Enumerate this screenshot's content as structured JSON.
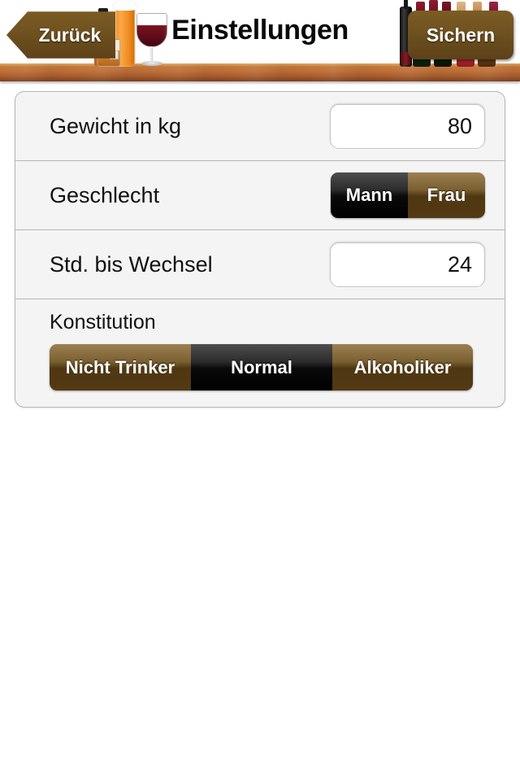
{
  "navbar": {
    "title": "Einstellungen",
    "back_label": "Zurück",
    "save_label": "Sichern",
    "colors": {
      "button_brown": "#6b4e1d",
      "shelf_wood": "#bd703a",
      "title_text": "#0a0a0a"
    },
    "decor": {
      "drinks_icon": "beer-wine-whiskey-glasses",
      "rack_icon": "wine-bottle-rack"
    }
  },
  "settings": {
    "weight": {
      "label": "Gewicht in kg",
      "value": "80",
      "placeholder": "kg"
    },
    "gender": {
      "label": "Geschlecht",
      "options": [
        "Mann",
        "Frau"
      ],
      "selected": "Mann"
    },
    "hours": {
      "label": "Std. bis Wechsel",
      "value": "24",
      "placeholder": "Std."
    },
    "constitution": {
      "label": "Konstitution",
      "options": [
        "Nicht Trinker",
        "Normal",
        "Alkoholiker"
      ],
      "selected": "Normal"
    },
    "colors": {
      "panel_bg": "#f4f4f4",
      "panel_border": "#b6b6b6",
      "segment_selected": "#000000",
      "segment_unselected": "#6b4e1d"
    }
  }
}
